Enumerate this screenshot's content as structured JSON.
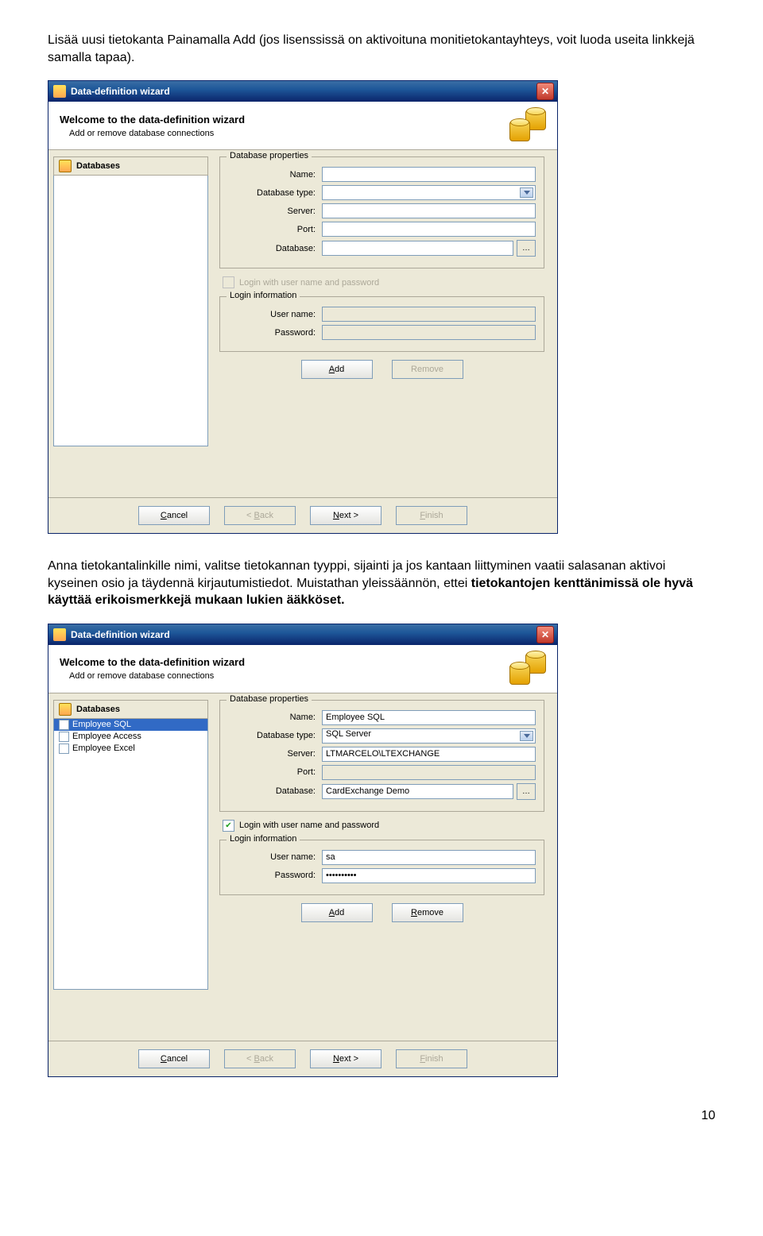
{
  "doc": {
    "para1": "Lisää uusi tietokanta Painamalla Add (jos lisenssissä on aktivoituna monitietokantayhteys, voit luoda useita linkkejä samalla tapaa).",
    "para2a": "Anna tietokantalinkille nimi, valitse tietokannan tyyppi, sijainti ja jos kantaan liittyminen vaatii salasanan aktivoi kyseinen osio ja täydennä kirjautumistiedot. Muistathan yleissäännön, ettei ",
    "para2b": "tietokantojen kenttänimissä ole hyvä käyttää erikoismerkkejä mukaan lukien ääkköset.",
    "page_number": "10"
  },
  "wizard": {
    "title": "Data-definition wizard",
    "banner_title": "Welcome to the data-definition wizard",
    "banner_sub": "Add or remove database connections",
    "sidebar_header": "Databases",
    "db_props_legend": "Database properties",
    "labels": {
      "name": "Name:",
      "database_type": "Database type:",
      "server": "Server:",
      "port": "Port:",
      "database": "Database:",
      "login_checkbox": "Login with user name and password",
      "login_legend": "Login information",
      "user_name": "User name:",
      "password": "Password:"
    },
    "buttons": {
      "add": "Add",
      "remove": "Remove",
      "cancel": "Cancel",
      "back": "< Back",
      "next": "Next >",
      "finish": "Finish"
    }
  },
  "wizard1_values": {
    "name": "",
    "database_type": "",
    "server": "",
    "port": "",
    "database": "",
    "login_checked": false,
    "user_name": "",
    "password": ""
  },
  "wizard2_values": {
    "sidebar_items": [
      "Employee SQL",
      "Employee Access",
      "Employee Excel"
    ],
    "name": "Employee SQL",
    "database_type": "SQL Server",
    "server": "LTMARCELO\\LTEXCHANGE",
    "port": "",
    "database": "CardExchange Demo",
    "login_checked": true,
    "user_name": "sa",
    "password": "••••••••••"
  }
}
